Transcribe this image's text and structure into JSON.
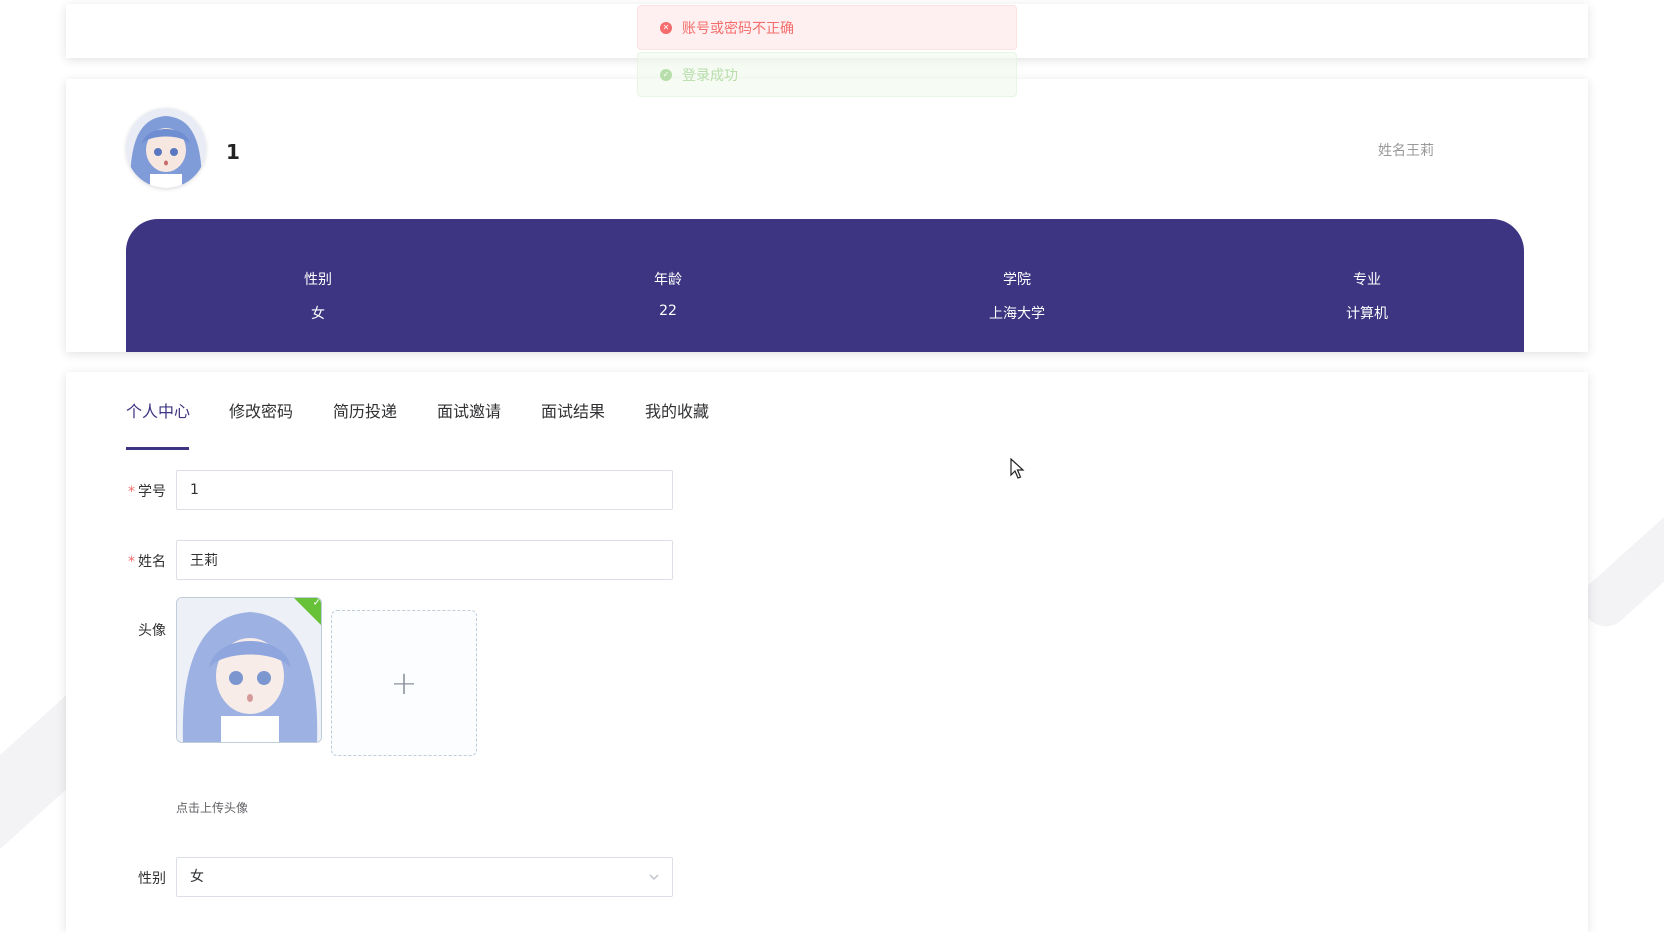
{
  "messages": {
    "error": "账号或密码不正确",
    "success": "登录成功"
  },
  "profile": {
    "id": "1",
    "name_display": "姓名王莉"
  },
  "stats": [
    {
      "label": "性别",
      "value": "女"
    },
    {
      "label": "年龄",
      "value": "22"
    },
    {
      "label": "学院",
      "value": "上海大学"
    },
    {
      "label": "专业",
      "value": "计算机"
    }
  ],
  "tabs": [
    {
      "label": "个人中心",
      "active": true
    },
    {
      "label": "修改密码",
      "active": false
    },
    {
      "label": "简历投递",
      "active": false
    },
    {
      "label": "面试邀请",
      "active": false
    },
    {
      "label": "面试结果",
      "active": false
    },
    {
      "label": "我的收藏",
      "active": false
    }
  ],
  "form": {
    "student_id": {
      "label": "学号",
      "value": "1",
      "required": true
    },
    "name": {
      "label": "姓名",
      "value": "王莉",
      "required": true
    },
    "avatar": {
      "label": "头像",
      "tip": "点击上传头像"
    },
    "gender": {
      "label": "性别",
      "value": "女"
    }
  },
  "colors": {
    "accent": "#3d3482",
    "error": "#f56c6c",
    "success": "#67c23a"
  },
  "icons": {
    "error": "circle-x-icon",
    "success": "circle-check-icon",
    "upload": "plus-icon",
    "select": "chevron-down-icon",
    "uploaded": "check-icon"
  }
}
